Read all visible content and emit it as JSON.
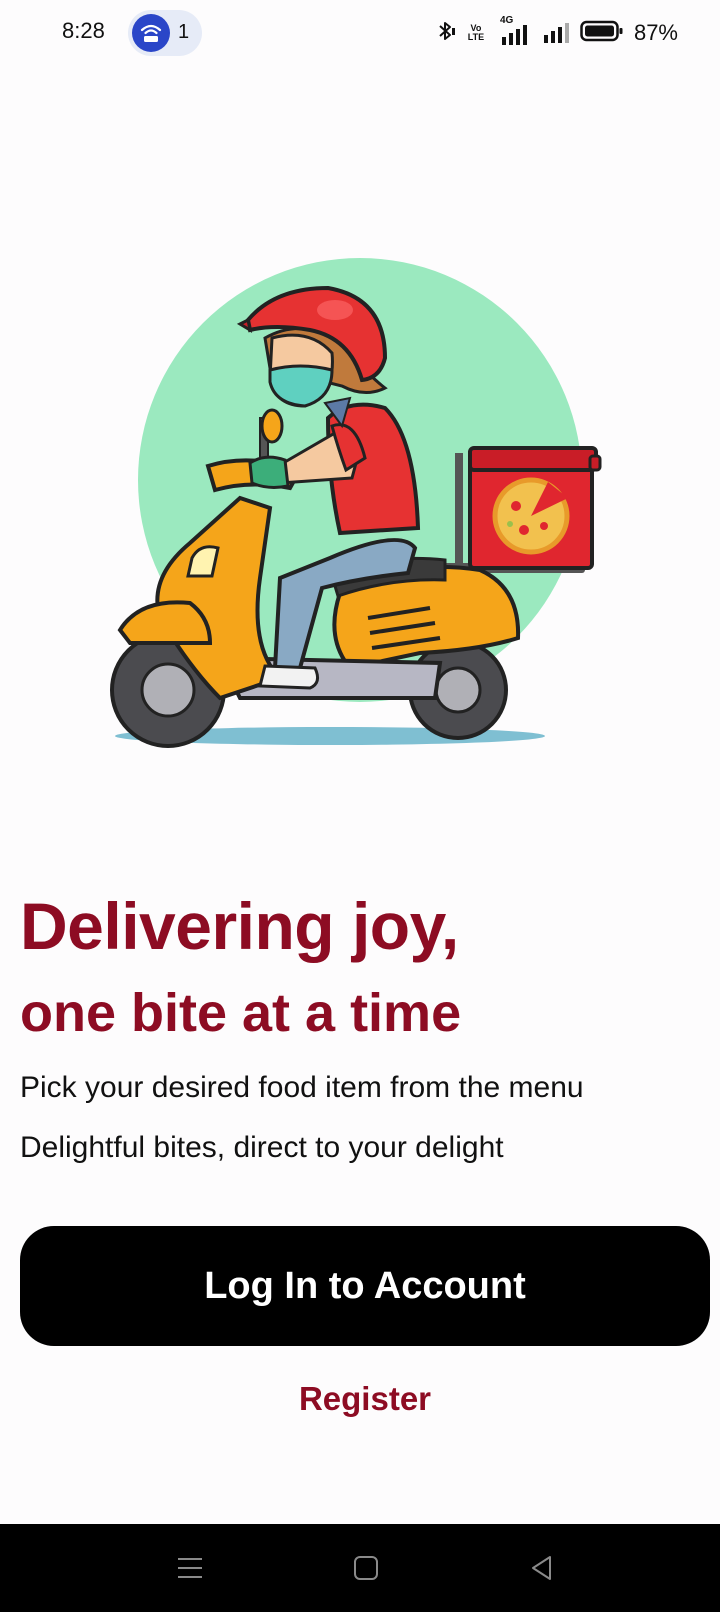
{
  "status_bar": {
    "time": "8:28",
    "notification_count": "1",
    "battery_percent": "87%",
    "network_label": "4G",
    "volte_label_top": "Vo",
    "volte_label_bottom": "LTE",
    "icons": [
      "hotspot-icon",
      "bluetooth-icon",
      "volte-icon",
      "signal-4g-icon",
      "signal-icon",
      "battery-icon"
    ]
  },
  "illustration": {
    "icon": "delivery-scooter-illustration",
    "colors": {
      "circle": "#9be9bf",
      "scooter": "#f5a51a",
      "shirt": "#e63232",
      "box": "#e0262f"
    }
  },
  "hero": {
    "headline_line1": "Delivering joy,",
    "headline_line2": "one bite at a time",
    "tagline_line1": "Pick your desired food item from the menu",
    "tagline_line2": "Delightful bites, direct to your delight"
  },
  "actions": {
    "login_label": "Log In to Account",
    "register_label": "Register"
  },
  "nav_bar": {
    "icons": [
      "menu-icon",
      "home-icon",
      "back-icon"
    ]
  },
  "colors": {
    "accent": "#8d0c23",
    "button_bg": "#000000",
    "button_text": "#ffffff"
  }
}
